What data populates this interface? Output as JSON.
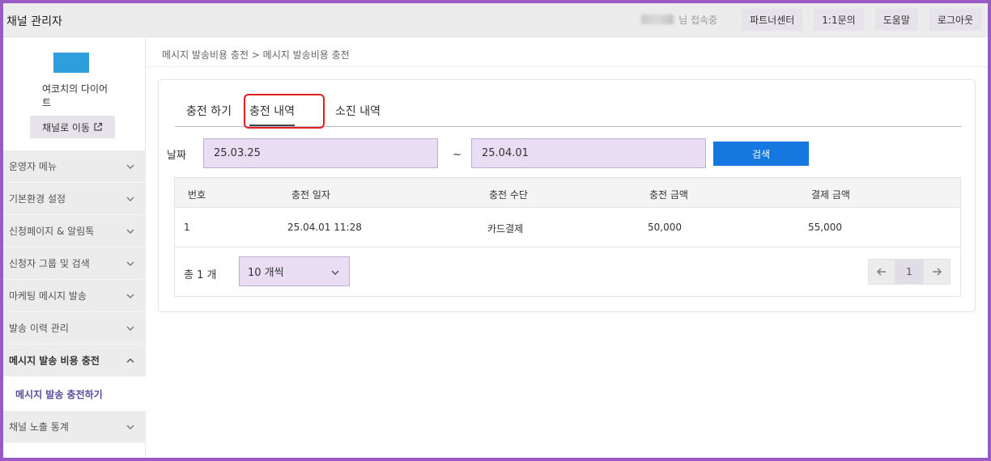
{
  "app": {
    "title": "채널 관리자"
  },
  "topbar": {
    "user_status": "님 접속중",
    "buttons": [
      "파트너센터",
      "1:1문의",
      "도움말",
      "로그아웃"
    ]
  },
  "sidebar": {
    "channel_name": "여코치의 다이어트",
    "channel_button": "채널로 이동",
    "menu": [
      {
        "label": "운영자 메뉴"
      },
      {
        "label": "기본환경 설정"
      },
      {
        "label": "신청페이지 & 알림톡"
      },
      {
        "label": "신청자 그룹 및 검색"
      },
      {
        "label": "마케팅 메시지 발송"
      },
      {
        "label": "발송 이력 관리"
      },
      {
        "label": "메시지 발송 비용 충전",
        "open": true,
        "sub": "메시지 발송 충전하기"
      },
      {
        "label": "채널 노출 통계"
      }
    ],
    "colors": {
      "logo": "#2e9fda",
      "active_sub": "#5a4a9e"
    }
  },
  "breadcrumb": "메시지 발송비용 충전 > 메시지 발송비용 충전",
  "tabs": [
    "충전 하기",
    "충전 내역",
    "소진 내역"
  ],
  "filter": {
    "label": "날짜",
    "start": "25.03.25",
    "end": "25.04.01",
    "tilde": "~",
    "search_button": "검색"
  },
  "table": {
    "headers": [
      "번호",
      "충전 일자",
      "충전 수단",
      "충전 금액",
      "결제 금액"
    ],
    "rows": [
      [
        "1",
        "25.04.01 11:28",
        "카드결제",
        "50,000",
        "55,000"
      ]
    ]
  },
  "footer": {
    "total": "총 1 개",
    "page_size": "10 개씩",
    "current_page": "1"
  },
  "colors": {
    "accent": "#1478e0",
    "highlight": "#e01e1e",
    "frame": "#9b59c4",
    "input_bg": "#e8ddf2"
  }
}
